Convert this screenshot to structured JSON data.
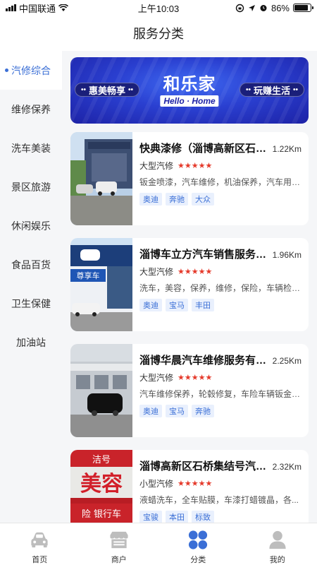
{
  "status_bar": {
    "carrier": "中国联通",
    "time": "上午10:03",
    "battery": "86%",
    "battery_level": 0.86
  },
  "nav": {
    "title": "服务分类"
  },
  "sidebar": {
    "items": [
      {
        "label": "汽修综合",
        "active": true
      },
      {
        "label": "维修保养"
      },
      {
        "label": "洗车美装"
      },
      {
        "label": "景区旅游"
      },
      {
        "label": "休闲娱乐"
      },
      {
        "label": "食品百货"
      },
      {
        "label": "卫生保健"
      },
      {
        "label": "加油站"
      }
    ]
  },
  "banner": {
    "left_tag": "惠美畅享",
    "right_tag": "玩赚生活",
    "title": "和乐家",
    "subtitle": "Hello · Home"
  },
  "cards": [
    {
      "name": "快典漆修（淄博高新区石桥...",
      "distance": "1.22Km",
      "type": "大型汽修",
      "stars": "★★★★★",
      "services": "钣金喷漆，汽车维修，机油保养，汽车用品...",
      "brands": [
        "奥迪",
        "奔驰",
        "大众"
      ]
    },
    {
      "name": "淄博车立方汽车销售服务有...",
      "distance": "1.96Km",
      "type": "大型汽修",
      "stars": "★★★★★",
      "services": "洗车，美容，保养，维修，保险，车辆检测...",
      "brands": [
        "奥迪",
        "宝马",
        "丰田"
      ],
      "sign_text": "尊享车"
    },
    {
      "name": "淄博华晨汽车维修服务有限...",
      "distance": "2.25Km",
      "type": "大型汽修",
      "stars": "★★★★★",
      "services": "汽车维修保养，轮毂修复，车险车辆钣金喷...",
      "brands": [
        "奥迪",
        "宝马",
        "奔驰"
      ]
    },
    {
      "name": "淄博高新区石桥集结号汽车...",
      "distance": "2.32Km",
      "type": "小型汽修",
      "stars": "★★★★★",
      "services": "液蜡洗车，全车贴膜，车漆打蜡镀晶，各...",
      "brands": [
        "宝骏",
        "本田",
        "标致"
      ],
      "sign_text_top": "洁号",
      "sign_text_mid": "美容",
      "sign_text_bottom": "险 银行车"
    }
  ],
  "tabs": [
    {
      "label": "首页",
      "icon": "car-icon"
    },
    {
      "label": "商户",
      "icon": "store-icon"
    },
    {
      "label": "分类",
      "icon": "category-icon",
      "active": true
    },
    {
      "label": "我的",
      "icon": "user-icon"
    }
  ],
  "colors": {
    "accent": "#3b6fd6",
    "star": "#e5392a",
    "tab_inactive": "#bdbdbd"
  }
}
